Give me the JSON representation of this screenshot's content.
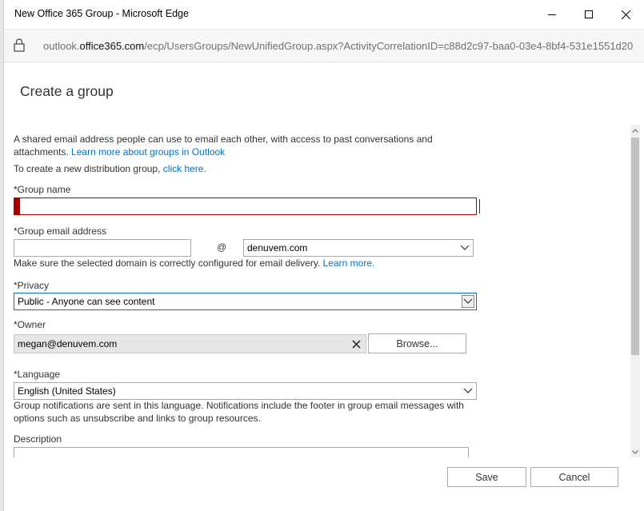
{
  "window": {
    "title": "New Office 365 Group - Microsoft Edge"
  },
  "address_bar": {
    "url_prefix": "outlook.",
    "url_host": "office365.com",
    "url_path": "/ecp/UsersGroups/NewUnifiedGroup.aspx?ActivityCorrelationID=c88d2c97-baa0-03e4-8bf4-531e1551d20"
  },
  "page": {
    "title": "Create a group"
  },
  "intro": {
    "text": "A shared email address people can use to email each other, with access to past conversations and attachments.",
    "learn_more": "Learn more about groups in Outlook",
    "distribution_text": "To create a new distribution group,",
    "click_here": "click here."
  },
  "group_name": {
    "label": "*Group name",
    "value": ""
  },
  "group_email": {
    "label": "*Group email address",
    "value": "",
    "at": "@",
    "domain": "denuvem.com",
    "hint": "Make sure the selected domain is correctly configured for email delivery.",
    "learn_more": "Learn more."
  },
  "privacy": {
    "label": "*Privacy",
    "value": "Public - Anyone can see content"
  },
  "owner": {
    "label": "*Owner",
    "value": "megan@denuvem.com",
    "browse_label": "Browse..."
  },
  "language": {
    "label": "*Language",
    "value": "English (United States)",
    "hint": "Group notifications are sent in this language. Notifications include the footer in group email messages with options such as unsubscribe and links to group resources."
  },
  "description": {
    "label": "Description",
    "value": ""
  },
  "footer": {
    "save_label": "Save",
    "cancel_label": "Cancel"
  },
  "colors": {
    "link": "#0072c6",
    "error": "#a80000",
    "focus": "#0072c6"
  },
  "icons": [
    "minimize-icon",
    "maximize-icon",
    "close-icon",
    "lock-icon",
    "chevron-down-icon",
    "remove-icon",
    "scroll-up-icon",
    "scroll-down-icon"
  ]
}
